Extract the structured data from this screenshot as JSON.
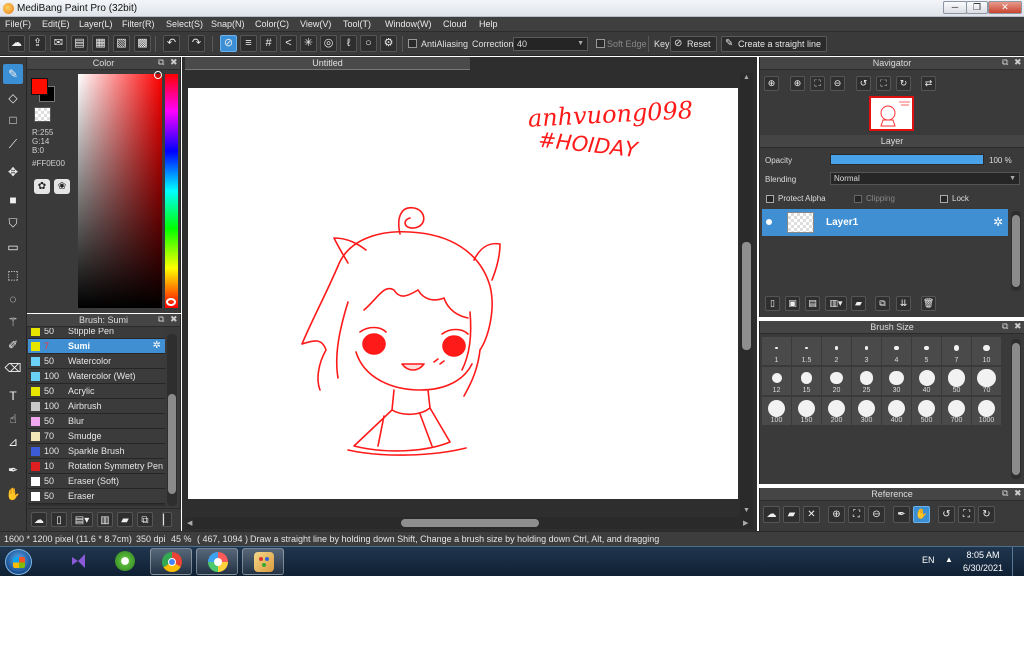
{
  "window": {
    "title": "MediBang Paint Pro (32bit)",
    "min_glyph": "─",
    "max_glyph": "❐",
    "close_glyph": "✕"
  },
  "menu": [
    "File(F)",
    "Edit(E)",
    "Layer(L)",
    "Filter(R)",
    "Select(S)",
    "Snap(N)",
    "Color(C)",
    "View(V)",
    "Tool(T)",
    "Window(W)",
    "Cloud",
    "Help"
  ],
  "toolbar": {
    "antialiasing_label": "AntiAliasing",
    "correction_label": "Correction",
    "correction_value": "40",
    "soft_edge_label": "Soft Edge",
    "key_label": "Key",
    "reset_label": "Reset",
    "create_line_label": "Create a straight line"
  },
  "color_panel": {
    "title": "Color",
    "r": "R:255",
    "g": "G:14",
    "b": "B:0",
    "hex": "#FF0E00",
    "main_color": "#ff0e00",
    "sub_color": "#000000"
  },
  "brush_panel": {
    "title": "Brush: Sumi",
    "brushes": [
      {
        "size": "50",
        "name": "Stipple Pen",
        "color": "#e6e600"
      },
      {
        "size": "7",
        "name": "Sumi",
        "color": "#e6e600",
        "selected": true
      },
      {
        "size": "50",
        "name": "Watercolor",
        "color": "#6bd0f5"
      },
      {
        "size": "100",
        "name": "Watercolor (Wet)",
        "color": "#6bd0f5"
      },
      {
        "size": "50",
        "name": "Acrylic",
        "color": "#e6e600"
      },
      {
        "size": "100",
        "name": "Airbrush",
        "color": "#c8c8c8"
      },
      {
        "size": "50",
        "name": "Blur",
        "color": "#f0a8f0"
      },
      {
        "size": "70",
        "name": "Smudge",
        "color": "#f5e6b8"
      },
      {
        "size": "100",
        "name": "Sparkle Brush",
        "color": "#3b5bd8"
      },
      {
        "size": "10",
        "name": "Rotation Symmetry Pen",
        "color": "#e02020"
      },
      {
        "size": "50",
        "name": "Eraser (Soft)",
        "color": "#ffffff"
      },
      {
        "size": "50",
        "name": "Eraser",
        "color": "#ffffff"
      }
    ]
  },
  "canvas": {
    "tab_title": "Untitled",
    "handwriting_1": "anhvuong098",
    "handwriting_2": "#HOIDAY"
  },
  "navigator": {
    "title": "Navigator"
  },
  "layer_panel": {
    "title": "Layer",
    "opacity_label": "Opacity",
    "opacity_value": "100 %",
    "opacity_fraction": 1.0,
    "blending_label": "Blending",
    "blending_value": "Normal",
    "protect_alpha_label": "Protect Alpha",
    "clipping_label": "Clipping",
    "lock_label": "Lock",
    "layer_name": "Layer1"
  },
  "brush_size_panel": {
    "title": "Brush Size",
    "sizes": [
      "1",
      "1.5",
      "2",
      "3",
      "4",
      "5",
      "7",
      "10",
      "12",
      "15",
      "20",
      "25",
      "30",
      "40",
      "50",
      "70",
      "100",
      "150",
      "200",
      "300",
      "400",
      "500",
      "700",
      "1000"
    ]
  },
  "reference_panel": {
    "title": "Reference"
  },
  "status": {
    "dimensions": "1600 * 1200 pixel",
    "physical_size": "(11.6 * 8.7cm)",
    "dpi": "350 dpi",
    "zoom": "45 %",
    "cursor_pos": "( 467, 1094 )",
    "hint": "Draw a straight line by holding down Shift, Change a brush size by holding down Ctrl, Alt, and dragging"
  },
  "taskbar": {
    "language": "EN",
    "tray_arrow": "▲",
    "time": "8:05 AM",
    "date": "6/30/2021"
  }
}
